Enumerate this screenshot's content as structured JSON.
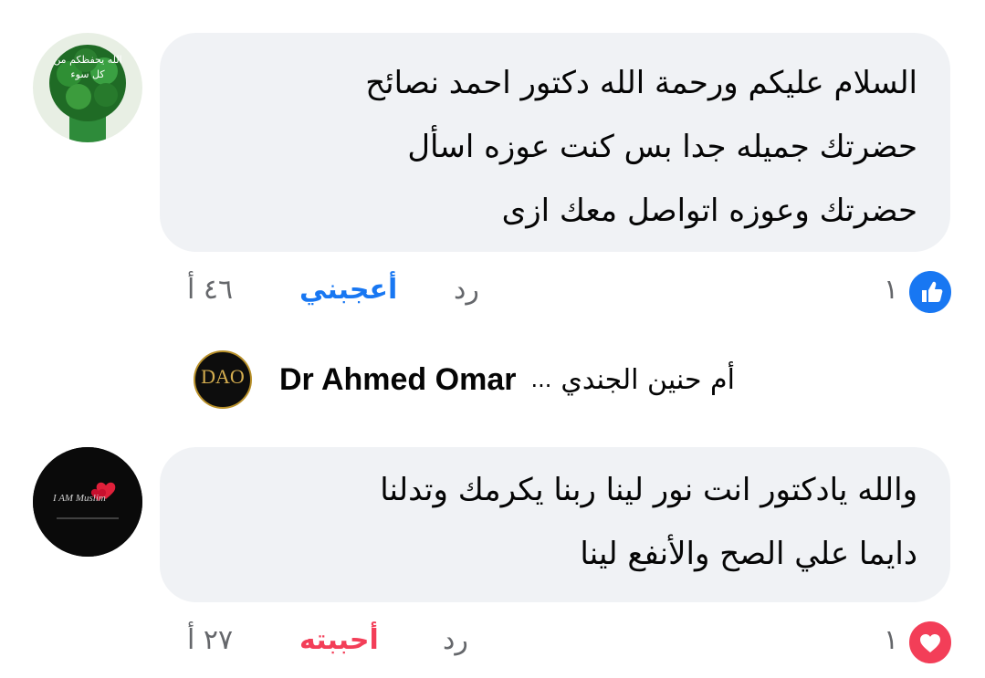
{
  "comments": [
    {
      "avatar_icon": "green-bouquet-avatar-icon",
      "avatar_text": "الله يحفظكم من كل سوء",
      "text": "السلام عليكم ورحمة الله دكتور احمد نصائح\nحضرتك جميله جدا بس كنت عوزه اسأل\nحضرتك وعوزه اتواصل معك ازى",
      "time": "٤٦ أ",
      "action_react": "أعجبني",
      "action_reply": "رد",
      "reaction_count": "١",
      "reaction_icon": "like-icon",
      "reaction_color": "#1877f2"
    },
    {
      "avatar_icon": "i-am-muslim-avatar-icon",
      "avatar_text": "I AM Muslim",
      "text": "والله يادكتور انت نور لينا ربنا يكرمك وتدلنا\nدايما علي الصح والأنفع لينا",
      "time": "٢٧ أ",
      "action_react": "أحببته",
      "action_reply": "رد",
      "reaction_count": "١",
      "reaction_icon": "love-icon",
      "reaction_color": "#f33e58"
    }
  ],
  "reply_thread": {
    "author": "Dr Ahmed Omar",
    "ellipsis": "...",
    "replier": "أم حنين الجندي",
    "avatar_text": "DAO",
    "avatar_icon": "dao-logo-avatar-icon"
  },
  "colors": {
    "bubble": "#f0f2f5",
    "like_blue": "#1877f2",
    "love_red": "#f33e58",
    "meta_grey": "#65676b"
  }
}
